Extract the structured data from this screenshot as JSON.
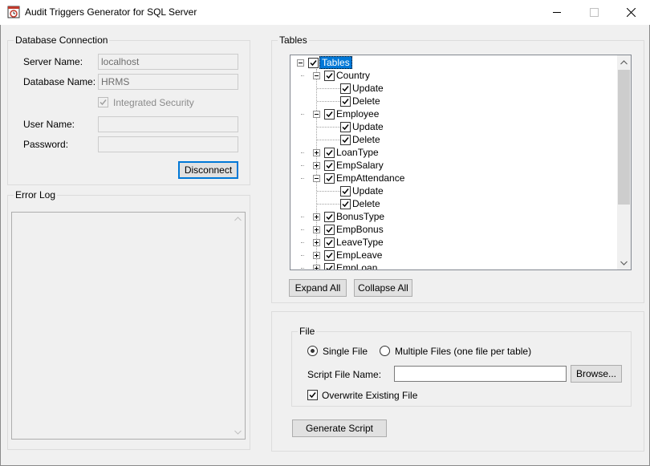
{
  "window": {
    "title": "Audit Triggers Generator for SQL Server"
  },
  "db_connection": {
    "group_title": "Database Connection",
    "server_label": "Server Name:",
    "server_value": "localhost",
    "database_label": "Database Name:",
    "database_value": "HRMS",
    "integrated_security_label": "Integrated Security",
    "integrated_security_checked": true,
    "username_label": "User Name:",
    "username_value": "",
    "password_label": "Password:",
    "password_value": "",
    "disconnect_label": "Disconnect"
  },
  "error_log": {
    "group_title": "Error Log",
    "content": ""
  },
  "tables": {
    "group_title": "Tables",
    "tree": [
      {
        "label": "Tables",
        "level": 0,
        "expander": "minus",
        "checked": true,
        "selected": true
      },
      {
        "label": "Country",
        "level": 1,
        "expander": "minus",
        "checked": true
      },
      {
        "label": "Update",
        "level": 2,
        "expander": "",
        "checked": true
      },
      {
        "label": "Delete",
        "level": 2,
        "expander": "",
        "checked": true
      },
      {
        "label": "Employee",
        "level": 1,
        "expander": "minus",
        "checked": true
      },
      {
        "label": "Update",
        "level": 2,
        "expander": "",
        "checked": true
      },
      {
        "label": "Delete",
        "level": 2,
        "expander": "",
        "checked": true
      },
      {
        "label": "LoanType",
        "level": 1,
        "expander": "plus",
        "checked": true
      },
      {
        "label": "EmpSalary",
        "level": 1,
        "expander": "plus",
        "checked": true
      },
      {
        "label": "EmpAttendance",
        "level": 1,
        "expander": "minus",
        "checked": true
      },
      {
        "label": "Update",
        "level": 2,
        "expander": "",
        "checked": true
      },
      {
        "label": "Delete",
        "level": 2,
        "expander": "",
        "checked": true
      },
      {
        "label": "BonusType",
        "level": 1,
        "expander": "plus",
        "checked": true
      },
      {
        "label": "EmpBonus",
        "level": 1,
        "expander": "plus",
        "checked": true
      },
      {
        "label": "LeaveType",
        "level": 1,
        "expander": "plus",
        "checked": true
      },
      {
        "label": "EmpLeave",
        "level": 1,
        "expander": "plus",
        "checked": true
      },
      {
        "label": "EmpLoan",
        "level": 1,
        "expander": "plus",
        "checked": true
      }
    ],
    "expand_all_label": "Expand All",
    "collapse_all_label": "Collapse All"
  },
  "file": {
    "group_title": "File",
    "single_file_label": "Single File",
    "single_file_selected": true,
    "multiple_files_label": "Multiple Files (one file per table)",
    "script_file_label": "Script File Name:",
    "script_file_value": "",
    "browse_label": "Browse...",
    "overwrite_label": "Overwrite Existing File",
    "overwrite_checked": true,
    "generate_label": "Generate Script"
  }
}
